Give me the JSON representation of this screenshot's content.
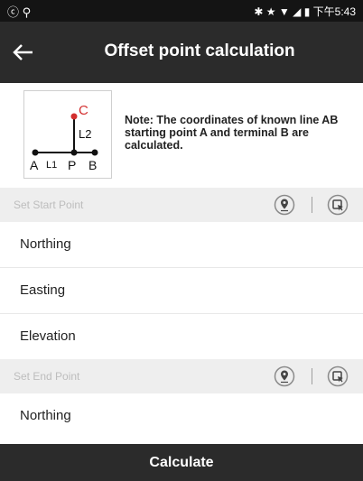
{
  "status_bar": {
    "left_icons": "ⓒ ⚲",
    "right_icons": "✱ ★ ▼ ◢",
    "time": "下午5:43"
  },
  "app_bar": {
    "title": "Offset point calculation"
  },
  "diagram": {
    "C": "C",
    "L2": "L2",
    "A": "A",
    "L1": "L1",
    "P": "P",
    "B": "B"
  },
  "note": "Note: The coordinates of known line AB starting point A and terminal B are calculated.",
  "start_section": {
    "label": "Set Start Point",
    "fields": [
      "Northing",
      "Easting",
      "Elevation"
    ]
  },
  "end_section": {
    "label": "Set End Point",
    "fields": [
      "Northing"
    ]
  },
  "calculate_label": "Calculate",
  "icons": {
    "back": "arrow-left-icon",
    "pin": "location-pin-icon",
    "select": "select-point-icon"
  },
  "colors": {
    "bar": "#2b2b2b",
    "section_bg": "#eeeeee",
    "accent_red": "#d32f2f"
  }
}
